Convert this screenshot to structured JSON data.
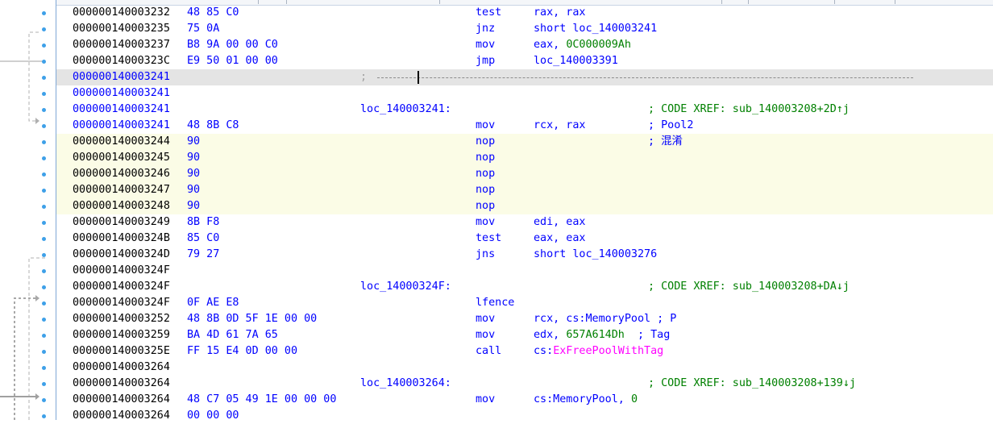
{
  "rows": [
    {
      "addr": "000000140003232",
      "bytes": "48 85 C0",
      "label": "",
      "mnem": "test",
      "ops": [
        {
          "t": "rax, rax",
          "c": ""
        }
      ],
      "cmt": "",
      "ctype": ""
    },
    {
      "addr": "000000140003235",
      "bytes": "75 0A",
      "label": "",
      "mnem": "jnz",
      "ops": [
        {
          "t": "short loc_140003241",
          "c": ""
        }
      ],
      "cmt": "",
      "ctype": ""
    },
    {
      "addr": "000000140003237",
      "bytes": "B8 9A 00 00 C0",
      "label": "",
      "mnem": "mov",
      "ops": [
        {
          "t": "eax, ",
          "c": ""
        },
        {
          "t": "0C000009Ah",
          "c": "num"
        }
      ],
      "cmt": "",
      "ctype": ""
    },
    {
      "addr": "00000014000323C",
      "bytes": "E9 50 01 00 00",
      "label": "",
      "mnem": "jmp",
      "ops": [
        {
          "t": "loc_140003391",
          "c": ""
        }
      ],
      "cmt": "",
      "ctype": ""
    },
    {
      "addr": "000000140003241",
      "bytes": "",
      "label": "",
      "mnem": "",
      "ops": [],
      "cmt": "",
      "ctype": "",
      "sep": "; ",
      "cur": true,
      "blue": true
    },
    {
      "addr": "000000140003241",
      "bytes": "",
      "label": "",
      "mnem": "",
      "ops": [],
      "cmt": "",
      "ctype": "",
      "blue": true
    },
    {
      "addr": "000000140003241",
      "bytes": "",
      "label": "loc_140003241:",
      "mnem": "",
      "ops": [],
      "cmt": "; CODE XREF: sub_140003208+2D↑j",
      "ctype": "green",
      "blue": true
    },
    {
      "addr": "000000140003241",
      "bytes": "48 8B C8",
      "label": "",
      "mnem": "mov",
      "ops": [
        {
          "t": "rcx, rax",
          "c": ""
        }
      ],
      "cmt": "; Pool2",
      "ctype": "",
      "blue": true
    },
    {
      "addr": "000000140003244",
      "bytes": "90",
      "label": "",
      "mnem": "nop",
      "ops": [],
      "cmt": "; 混淆",
      "ctype": "",
      "hl": true
    },
    {
      "addr": "000000140003245",
      "bytes": "90",
      "label": "",
      "mnem": "nop",
      "ops": [],
      "cmt": "",
      "ctype": "",
      "hl": true
    },
    {
      "addr": "000000140003246",
      "bytes": "90",
      "label": "",
      "mnem": "nop",
      "ops": [],
      "cmt": "",
      "ctype": "",
      "hl": true
    },
    {
      "addr": "000000140003247",
      "bytes": "90",
      "label": "",
      "mnem": "nop",
      "ops": [],
      "cmt": "",
      "ctype": "",
      "hl": true
    },
    {
      "addr": "000000140003248",
      "bytes": "90",
      "label": "",
      "mnem": "nop",
      "ops": [],
      "cmt": "",
      "ctype": "",
      "hl": true
    },
    {
      "addr": "000000140003249",
      "bytes": "8B F8",
      "label": "",
      "mnem": "mov",
      "ops": [
        {
          "t": "edi, eax",
          "c": ""
        }
      ],
      "cmt": "",
      "ctype": ""
    },
    {
      "addr": "00000014000324B",
      "bytes": "85 C0",
      "label": "",
      "mnem": "test",
      "ops": [
        {
          "t": "eax, eax",
          "c": ""
        }
      ],
      "cmt": "",
      "ctype": ""
    },
    {
      "addr": "00000014000324D",
      "bytes": "79 27",
      "label": "",
      "mnem": "jns",
      "ops": [
        {
          "t": "short loc_140003276",
          "c": ""
        }
      ],
      "cmt": "",
      "ctype": ""
    },
    {
      "addr": "00000014000324F",
      "bytes": "",
      "label": "",
      "mnem": "",
      "ops": [],
      "cmt": "",
      "ctype": ""
    },
    {
      "addr": "00000014000324F",
      "bytes": "",
      "label": "loc_14000324F:",
      "mnem": "",
      "ops": [],
      "cmt": "; CODE XREF: sub_140003208+DA↓j",
      "ctype": "green"
    },
    {
      "addr": "00000014000324F",
      "bytes": "0F AE E8",
      "label": "",
      "mnem": "lfence",
      "ops": [],
      "cmt": "",
      "ctype": ""
    },
    {
      "addr": "000000140003252",
      "bytes": "48 8B 0D 5F 1E 00 00",
      "label": "",
      "mnem": "mov",
      "ops": [
        {
          "t": "rcx, cs:MemoryPool ; P",
          "c": ""
        }
      ],
      "cmt": "",
      "ctype": ""
    },
    {
      "addr": "000000140003259",
      "bytes": "BA 4D 61 7A 65",
      "label": "",
      "mnem": "mov",
      "ops": [
        {
          "t": "edx, ",
          "c": ""
        },
        {
          "t": "657A614Dh",
          "c": "num"
        },
        {
          "t": "  ; Tag",
          "c": ""
        }
      ],
      "cmt": "",
      "ctype": ""
    },
    {
      "addr": "00000014000325E",
      "bytes": "FF 15 E4 0D 00 00",
      "label": "",
      "mnem": "call",
      "ops": [
        {
          "t": "cs:",
          "c": ""
        },
        {
          "t": "ExFreePoolWithTag",
          "c": "ext"
        }
      ],
      "cmt": "",
      "ctype": ""
    },
    {
      "addr": "000000140003264",
      "bytes": "",
      "label": "",
      "mnem": "",
      "ops": [],
      "cmt": "",
      "ctype": ""
    },
    {
      "addr": "000000140003264",
      "bytes": "",
      "label": "loc_140003264:",
      "mnem": "",
      "ops": [],
      "cmt": "; CODE XREF: sub_140003208+139↓j",
      "ctype": "green"
    },
    {
      "addr": "000000140003264",
      "bytes": "48 C7 05 49 1E 00 00 00",
      "label": "",
      "mnem": "mov",
      "ops": [
        {
          "t": "cs:MemoryPool, ",
          "c": ""
        },
        {
          "t": "0",
          "c": "num"
        }
      ],
      "cmt": "",
      "ctype": ""
    },
    {
      "addr": "000000140003264",
      "bytes": "00 00 00",
      "label": "",
      "mnem": "",
      "ops": [],
      "cmt": "",
      "ctype": ""
    }
  ]
}
